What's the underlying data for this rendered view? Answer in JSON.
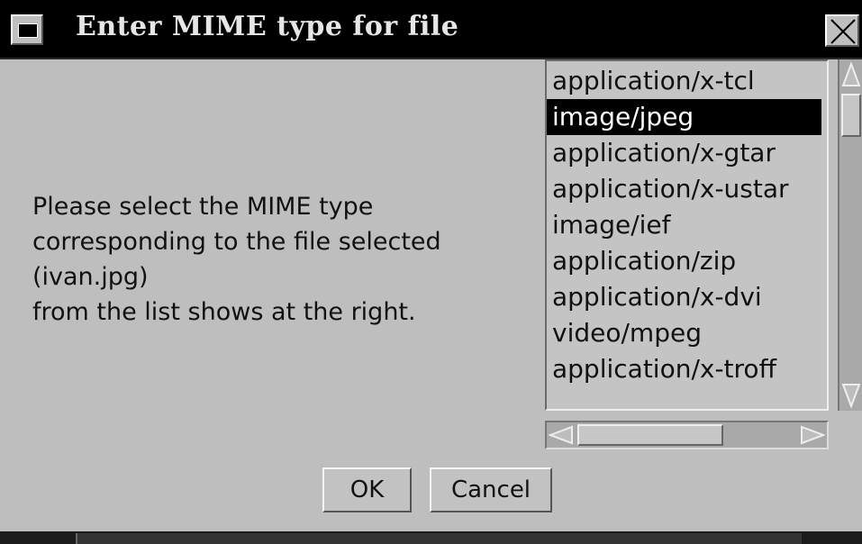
{
  "window": {
    "title": "Enter MIME type for file"
  },
  "message": {
    "lines": [
      "Please select the MIME type",
      "corresponding to the file selected",
      "(ivan.jpg)",
      "from the list shows at the right."
    ]
  },
  "mime_list": {
    "items": [
      "application/x-tcl",
      "image/jpeg",
      "application/x-gtar",
      "application/x-ustar",
      "image/ief",
      "application/zip",
      "application/x-dvi",
      "video/mpeg",
      "application/x-troff"
    ],
    "selected": "image/jpeg"
  },
  "buttons": {
    "ok": "OK",
    "cancel": "Cancel"
  },
  "icons": {
    "window_menu": "window-menu-icon",
    "close": "close-icon",
    "scroll_up": "arrow-up-icon",
    "scroll_down": "arrow-down-icon",
    "scroll_left": "arrow-left-icon",
    "scroll_right": "arrow-right-icon"
  },
  "colors": {
    "selection_bg": "#000000",
    "dialog_bg": "#bebebe"
  }
}
